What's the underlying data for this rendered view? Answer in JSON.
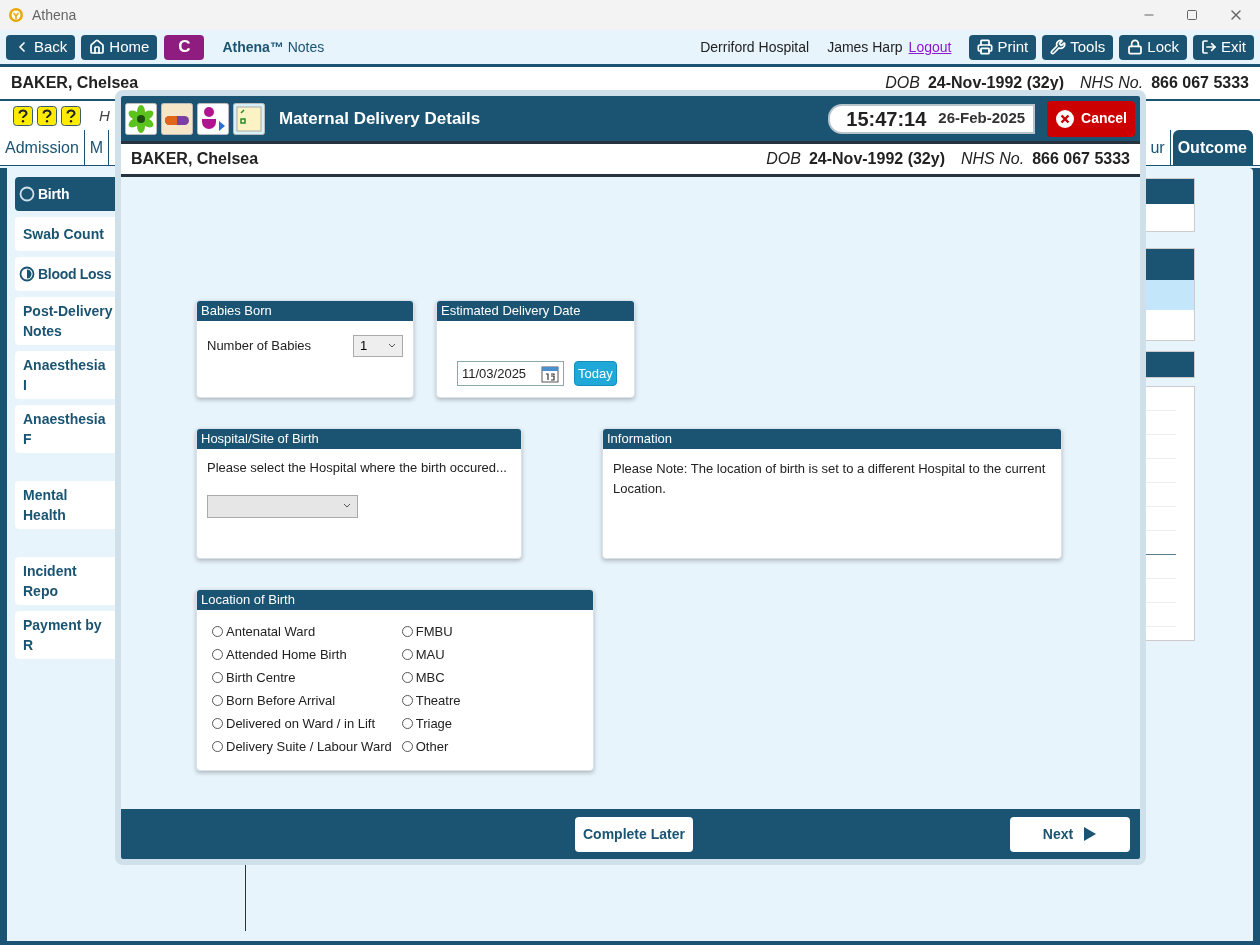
{
  "window": {
    "title": "Athena"
  },
  "toolbar": {
    "left_buttons": [
      {
        "kind": "back",
        "label": "Back"
      },
      {
        "kind": "home",
        "label": "Home"
      }
    ],
    "badge": "C",
    "app_name": "**Athena™** Notes",
    "hospital": "Derriford Hospital",
    "user": "James Harp",
    "logout": "Logout",
    "right_buttons": [
      {
        "kind": "print",
        "label": "Print"
      },
      {
        "kind": "tools",
        "label": "Tools"
      },
      {
        "kind": "lock",
        "label": "Lock"
      },
      {
        "kind": "exit",
        "label": "Exit"
      }
    ]
  },
  "patient": {
    "name": "BAKER, Chelsea",
    "dob_label": "DOB",
    "dob": "24-Nov-1992 (32y)",
    "nhs_label": "NHS No.",
    "nhs": "866 067 5333"
  },
  "subheader": {
    "text": "H"
  },
  "tabs": [
    {
      "label": "Admission",
      "selected": false
    },
    {
      "label": "M",
      "selected": false
    },
    {
      "label": "ur",
      "selected": false
    },
    {
      "label": "Outcome",
      "selected": true
    }
  ],
  "sidebar": {
    "groups": [
      [
        {
          "label": "Birth",
          "selected": true,
          "kind": "empty"
        },
        {
          "label": "Swab Count",
          "selected": false
        },
        {
          "label": "Blood Loss",
          "selected": false,
          "kind": "partial"
        },
        {
          "label": "Post-Delivery Notes",
          "selected": false
        },
        {
          "label": "Anaesthesia I",
          "selected": false
        },
        {
          "label": "Anaesthesia F",
          "selected": false
        }
      ],
      [
        {
          "label": "Mental Health",
          "selected": false
        }
      ],
      [
        {
          "label": "Incident Repo",
          "selected": false
        },
        {
          "label": "Payment by R",
          "selected": false
        }
      ]
    ]
  },
  "modal": {
    "title": "Maternal Delivery Details",
    "time": "15:47:14",
    "date": "26-Feb-2025",
    "cancel": "Cancel",
    "patient": {
      "name": "BAKER, Chelsea",
      "dob_label": "DOB",
      "dob": "24-Nov-1992 (32y)",
      "nhs_label": "NHS No.",
      "nhs": "866 067 5333"
    },
    "babies": {
      "title": "Babies Born",
      "label": "Number of Babies",
      "value": "1"
    },
    "edd": {
      "title": "Estimated Delivery Date",
      "value": "11/03/2025",
      "today": "Today"
    },
    "hospital": {
      "title": "Hospital/Site of Birth",
      "prompt": "Please select the Hospital where the birth occured..."
    },
    "information": {
      "title": "Information",
      "text": "Please Note: The location of birth is set to a different Hospital to the current Location."
    },
    "location": {
      "title": "Location of Birth",
      "options": [
        {
          "label": "Antenatal Ward",
          "selected": false
        },
        {
          "label": "Attended Home Birth",
          "selected": false
        },
        {
          "label": "Birth Centre",
          "selected": false
        },
        {
          "label": "Born Before Arrival",
          "selected": false
        },
        {
          "label": "Delivered on Ward / in Lift",
          "selected": false
        },
        {
          "label": "Delivery Suite / Labour Ward",
          "selected": false
        },
        {
          "label": "FMBU",
          "selected": false
        },
        {
          "label": "MAU",
          "selected": false
        },
        {
          "label": "MBC",
          "selected": false
        },
        {
          "label": "Theatre",
          "selected": false
        },
        {
          "label": "Triage",
          "selected": false
        },
        {
          "label": "Other",
          "selected": false
        }
      ]
    },
    "footer": {
      "secondary": "Complete Later",
      "primary": "Next"
    }
  }
}
